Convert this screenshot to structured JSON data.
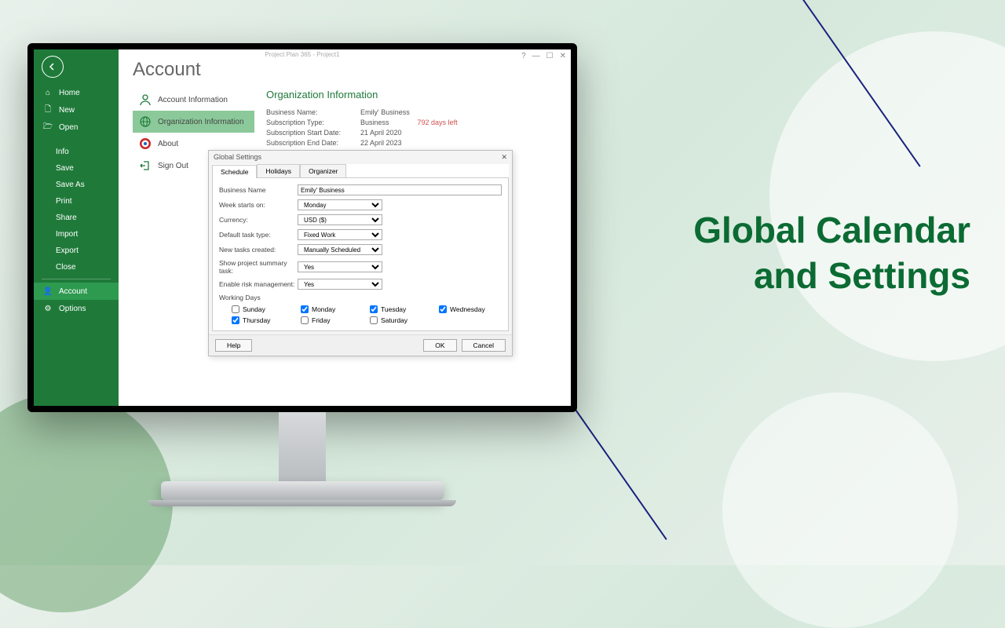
{
  "hero": {
    "line1": "Global Calendar",
    "line2": "and Settings"
  },
  "window": {
    "title": "Project Plan 365 - Project1",
    "help": "?",
    "min": "—",
    "max": "☐",
    "close": "✕"
  },
  "sidebar": {
    "home": "Home",
    "new": "New",
    "open": "Open",
    "info": "Info",
    "save": "Save",
    "saveas": "Save As",
    "print": "Print",
    "share": "Share",
    "import": "Import",
    "export": "Export",
    "close": "Close",
    "account": "Account",
    "options": "Options"
  },
  "page": {
    "title": "Account"
  },
  "acct": {
    "info": "Account Information",
    "org": "Organization Information",
    "about": "About",
    "signout": "Sign Out"
  },
  "org": {
    "title": "Organization Information",
    "bn_l": "Business Name:",
    "bn_v": "Emily' Business",
    "st_l": "Subscription Type:",
    "st_v": "Business",
    "st_ext": "792 days left",
    "ssd_l": "Subscription Start Date:",
    "ssd_v": "21 April 2020",
    "sed_l": "Subscription End Date:",
    "sed_v": "22 April 2023"
  },
  "dialog": {
    "title": "Global Settings",
    "close": "✕",
    "tabs": {
      "schedule": "Schedule",
      "holidays": "Holidays",
      "organizer": "Organizer"
    },
    "fields": {
      "bn_l": "Business Name",
      "bn_v": "Emily' Business",
      "ws_l": "Week starts on:",
      "ws_v": "Monday",
      "cur_l": "Currency:",
      "cur_v": "USD ($)",
      "dtt_l": "Default task type:",
      "dtt_v": "Fixed Work",
      "ntc_l": "New tasks created:",
      "ntc_v": "Manually Scheduled",
      "sps_l": "Show project summary task:",
      "sps_v": "Yes",
      "erm_l": "Enable risk management:",
      "erm_v": "Yes"
    },
    "wd": "Working Days",
    "days": {
      "sun": "Sunday",
      "mon": "Monday",
      "tue": "Tuesday",
      "wed": "Wednesday",
      "thu": "Thursday",
      "fri": "Friday",
      "sat": "Saturday"
    },
    "checked": {
      "sun": false,
      "mon": true,
      "tue": true,
      "wed": true,
      "thu": true,
      "fri": false,
      "sat": false
    },
    "buttons": {
      "help": "Help",
      "ok": "OK",
      "cancel": "Cancel"
    }
  }
}
